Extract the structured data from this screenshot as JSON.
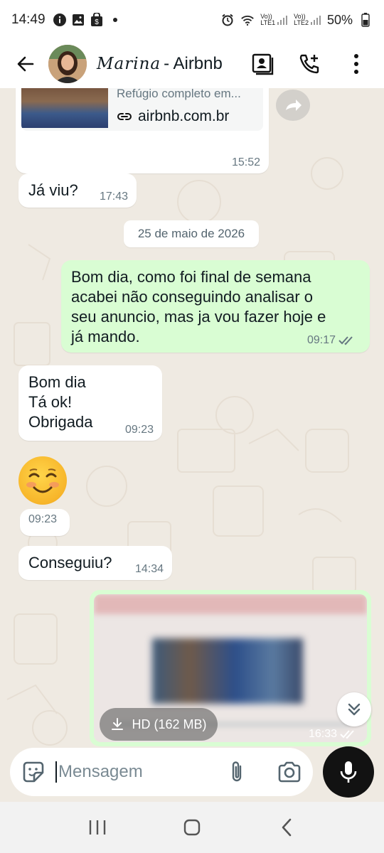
{
  "status_bar": {
    "time": "14:49",
    "battery": "50%",
    "left_icons": [
      "info-icon",
      "image-icon",
      "shopping-bag-icon",
      "dot-icon"
    ],
    "right_icons": [
      "alarm-icon",
      "wifi-icon",
      "volte-sim1-icon",
      "volte-sim2-icon",
      "battery-icon"
    ],
    "sim1": "LTE1",
    "sim2": "LTE2"
  },
  "header": {
    "contact_script": "Marina",
    "contact_name": "- Airbnb",
    "actions": [
      "contact-card-icon",
      "add-call-icon",
      "more-vert-icon"
    ]
  },
  "messages": {
    "link_preview": {
      "description": "Refúgio completo em...",
      "domain": "airbnb.com.br",
      "time": "15:52"
    },
    "m1": {
      "text": "Já viu?",
      "time": "17:43"
    },
    "date_separator": "25 de maio de 2026",
    "m2": {
      "text": "Bom dia, como foi final de semana\nacabei não conseguindo analisar o\nseu anuncio, mas ja vou fazer hoje e\njá mando.",
      "time": "09:17"
    },
    "m3": {
      "text": "Bom dia\nTá ok!\n  Obrigada",
      "time": "09:23"
    },
    "m4": {
      "emoji": "☺️",
      "time": "09:23"
    },
    "m5": {
      "text": "Conseguiu?",
      "time": "14:34"
    },
    "media": {
      "hd_label": "HD (162 MB)",
      "time": "16:33"
    }
  },
  "input": {
    "placeholder": "Mensagem"
  },
  "colors": {
    "chat_background": "#efeae2",
    "outgoing_bubble": "#d9fdd3",
    "incoming_bubble": "#ffffff",
    "read_ticks": "#667781"
  }
}
